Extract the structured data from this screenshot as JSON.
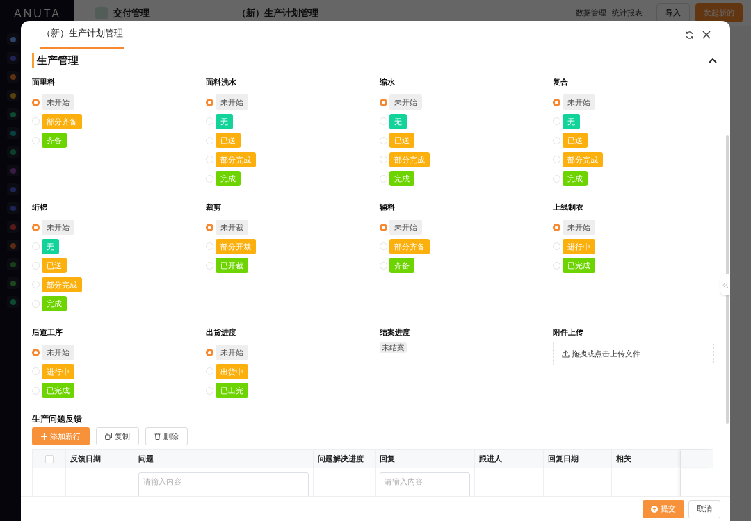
{
  "background": {
    "logo": "ANUTA",
    "app_tab": "交付管理",
    "page_title": "（新）生产计划管理",
    "toolbar": [
      "数据管理",
      "统计报表"
    ],
    "import_button": "导入",
    "new_button": "发起新的"
  },
  "modal": {
    "title": "（新）生产计划管理",
    "section": "生产管理",
    "fields": [
      {
        "label": "面里料",
        "kind": "radio",
        "options": [
          {
            "label": "未开始",
            "color": "#eeeeee",
            "selected": true
          },
          {
            "label": "部分齐备",
            "color": "#fbb00e",
            "selected": false
          },
          {
            "label": "齐备",
            "color": "#6dd400",
            "selected": false
          }
        ]
      },
      {
        "label": "面料洗水",
        "kind": "radio",
        "options": [
          {
            "label": "未开始",
            "color": "#eeeeee",
            "selected": true
          },
          {
            "label": "无",
            "color": "#12d39a",
            "selected": false
          },
          {
            "label": "已送",
            "color": "#fbb00e",
            "selected": false
          },
          {
            "label": "部分完成",
            "color": "#fbb00e",
            "selected": false
          },
          {
            "label": "完成",
            "color": "#6dd400",
            "selected": false
          }
        ]
      },
      {
        "label": "缩水",
        "kind": "radio",
        "options": [
          {
            "label": "未开始",
            "color": "#eeeeee",
            "selected": true
          },
          {
            "label": "无",
            "color": "#12d39a",
            "selected": false
          },
          {
            "label": "已送",
            "color": "#fbb00e",
            "selected": false
          },
          {
            "label": "部分完成",
            "color": "#fbb00e",
            "selected": false
          },
          {
            "label": "完成",
            "color": "#6dd400",
            "selected": false
          }
        ]
      },
      {
        "label": "复合",
        "kind": "radio",
        "options": [
          {
            "label": "未开始",
            "color": "#eeeeee",
            "selected": true
          },
          {
            "label": "无",
            "color": "#12d39a",
            "selected": false
          },
          {
            "label": "已送",
            "color": "#fbb00e",
            "selected": false
          },
          {
            "label": "部分完成",
            "color": "#fbb00e",
            "selected": false
          },
          {
            "label": "完成",
            "color": "#6dd400",
            "selected": false
          }
        ]
      },
      {
        "label": "绗棉",
        "kind": "radio",
        "options": [
          {
            "label": "未开始",
            "color": "#eeeeee",
            "selected": true
          },
          {
            "label": "无",
            "color": "#12d39a",
            "selected": false
          },
          {
            "label": "已送",
            "color": "#fbb00e",
            "selected": false
          },
          {
            "label": "部分完成",
            "color": "#fbb00e",
            "selected": false
          },
          {
            "label": "完成",
            "color": "#6dd400",
            "selected": false
          }
        ]
      },
      {
        "label": "裁剪",
        "kind": "radio",
        "options": [
          {
            "label": "未开裁",
            "color": "#eeeeee",
            "selected": true
          },
          {
            "label": "部分开裁",
            "color": "#fbb00e",
            "selected": false
          },
          {
            "label": "已开裁",
            "color": "#6dd400",
            "selected": false
          }
        ]
      },
      {
        "label": "辅料",
        "kind": "radio",
        "options": [
          {
            "label": "未开始",
            "color": "#eeeeee",
            "selected": true
          },
          {
            "label": "部分齐备",
            "color": "#fbb00e",
            "selected": false
          },
          {
            "label": "齐备",
            "color": "#6dd400",
            "selected": false
          }
        ]
      },
      {
        "label": "上线制衣",
        "kind": "radio",
        "options": [
          {
            "label": "未开始",
            "color": "#eeeeee",
            "selected": true
          },
          {
            "label": "进行中",
            "color": "#fbb00e",
            "selected": false
          },
          {
            "label": "已完成",
            "color": "#6dd400",
            "selected": false
          }
        ]
      },
      {
        "label": "后道工序",
        "kind": "radio",
        "options": [
          {
            "label": "未开始",
            "color": "#eeeeee",
            "selected": true
          },
          {
            "label": "进行中",
            "color": "#fbb00e",
            "selected": false
          },
          {
            "label": "已完成",
            "color": "#6dd400",
            "selected": false
          }
        ]
      },
      {
        "label": "出货进度",
        "kind": "radio",
        "options": [
          {
            "label": "未开始",
            "color": "#eeeeee",
            "selected": true
          },
          {
            "label": "出货中",
            "color": "#fbb00e",
            "selected": false
          },
          {
            "label": "已出完",
            "color": "#6dd400",
            "selected": false
          }
        ]
      },
      {
        "label": "结案进度",
        "kind": "tag",
        "value": "未结案"
      },
      {
        "label": "附件上传",
        "kind": "upload",
        "text": "拖拽或点击上传文件"
      }
    ],
    "feedback": {
      "title": "生产问题反馈",
      "buttons": [
        {
          "label": "添加新行",
          "kind": "primary"
        },
        {
          "label": "复制",
          "kind": "copy"
        },
        {
          "label": "删除",
          "kind": "delete"
        }
      ],
      "columns": [
        "反馈日期",
        "问题",
        "问题解决进度",
        "回复",
        "跟进人",
        "回复日期",
        "相关"
      ],
      "row": [
        {
          "kind": "empty"
        },
        {
          "kind": "input",
          "placeholder": "请输入内容"
        },
        {
          "kind": "empty"
        },
        {
          "kind": "input",
          "placeholder": "请输入内容"
        },
        {
          "kind": "empty"
        },
        {
          "kind": "empty"
        },
        {
          "kind": "empty"
        }
      ],
      "checked": false
    },
    "footer_buttons": [
      {
        "label": "提交",
        "kind": "primary"
      },
      {
        "label": "取消",
        "kind": "default"
      }
    ]
  }
}
